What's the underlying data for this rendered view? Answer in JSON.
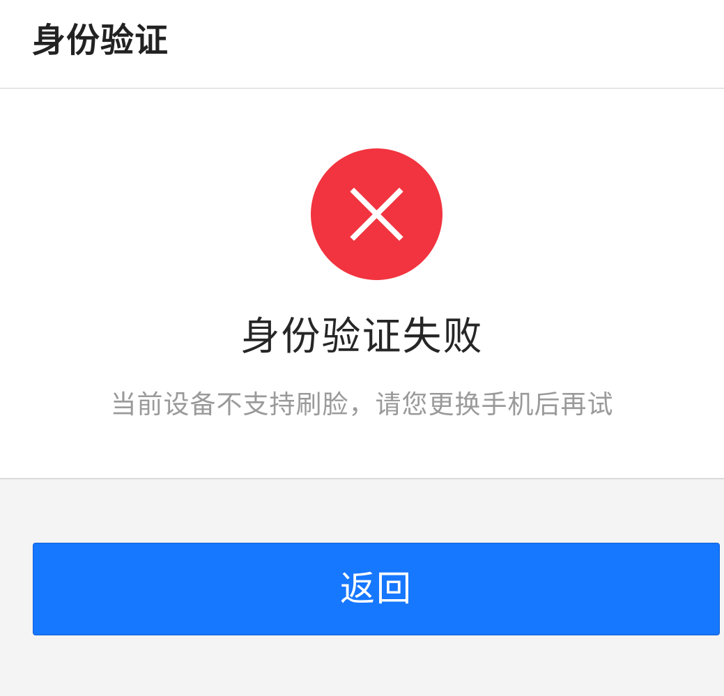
{
  "header": {
    "title": "身份验证"
  },
  "result": {
    "icon": "close-icon",
    "icon_color": "#f1343f",
    "title": "身份验证失败",
    "message": "当前设备不支持刷脸，请您更换手机后再试"
  },
  "actions": {
    "back_label": "返回",
    "back_color": "#1677ff"
  }
}
